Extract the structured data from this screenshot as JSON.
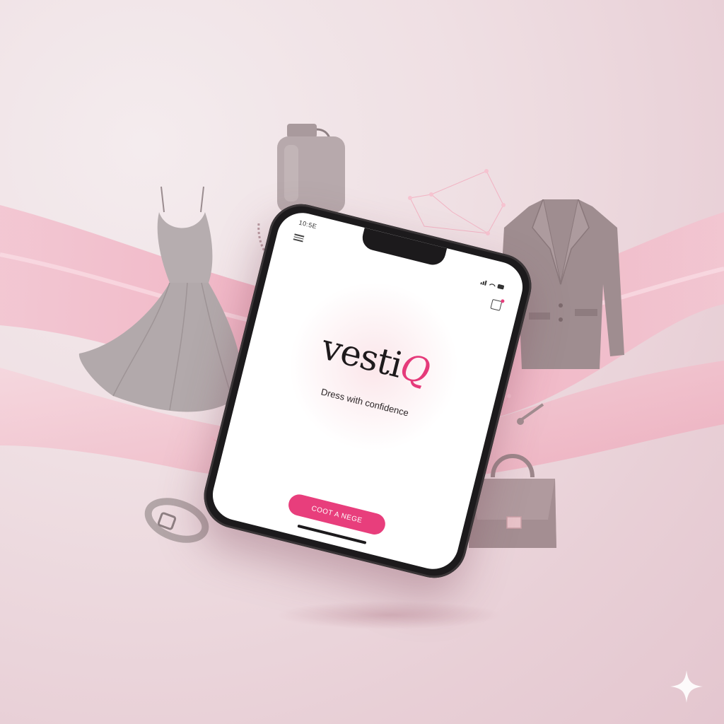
{
  "colors": {
    "brand": "#e83e7c",
    "background": "#efdfe3",
    "ribbon": "#f0aabd",
    "product": "#a8969a"
  },
  "status_bar": {
    "time": "10:5E"
  },
  "app": {
    "logo_main": "vesti",
    "logo_accent": "Q",
    "tagline": "Dress with confidence",
    "cta_label": "COOT A NEGE"
  },
  "icons": {
    "menu": "hamburger-menu-icon",
    "cart": "cart-icon",
    "signal": "signal-icon",
    "wifi": "wifi-icon",
    "battery": "battery-icon",
    "sparkle": "sparkle-icon"
  }
}
